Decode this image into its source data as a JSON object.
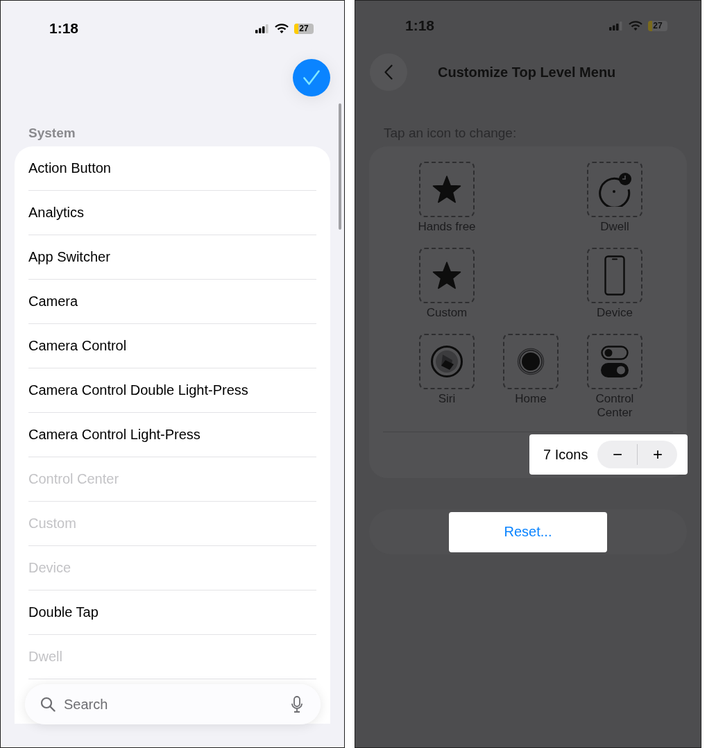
{
  "left_screen": {
    "status_bar": {
      "time": "1:18",
      "battery": "27"
    },
    "section_header": "System",
    "items": [
      {
        "label": "Action Button",
        "disabled": false
      },
      {
        "label": "Analytics",
        "disabled": false
      },
      {
        "label": "App Switcher",
        "disabled": false
      },
      {
        "label": "Camera",
        "disabled": false
      },
      {
        "label": "Camera Control",
        "disabled": false
      },
      {
        "label": "Camera Control Double Light-Press",
        "disabled": false
      },
      {
        "label": "Camera Control Light-Press",
        "disabled": false
      },
      {
        "label": "Control Center",
        "disabled": true
      },
      {
        "label": "Custom",
        "disabled": true
      },
      {
        "label": "Device",
        "disabled": true
      },
      {
        "label": "Double Tap",
        "disabled": false
      },
      {
        "label": "Dwell",
        "disabled": true
      }
    ],
    "search": {
      "placeholder": "Search"
    }
  },
  "right_screen": {
    "status_bar": {
      "time": "1:18",
      "battery": "27"
    },
    "title": "Customize Top Level Menu",
    "instruction": "Tap an icon to change:",
    "icons": [
      {
        "label": "Hands free",
        "kind": "star"
      },
      {
        "label": "Dwell",
        "kind": "dwell"
      },
      {
        "label": "Custom",
        "kind": "star"
      },
      {
        "label": "Device",
        "kind": "phone"
      },
      {
        "label": "Siri",
        "kind": "siri"
      },
      {
        "label": "Home",
        "kind": "home"
      },
      {
        "label": "Control Center",
        "kind": "toggles"
      }
    ],
    "icon_count": "7 Icons",
    "stepper": [
      "−",
      "+"
    ],
    "reset_button": "Reset..."
  }
}
